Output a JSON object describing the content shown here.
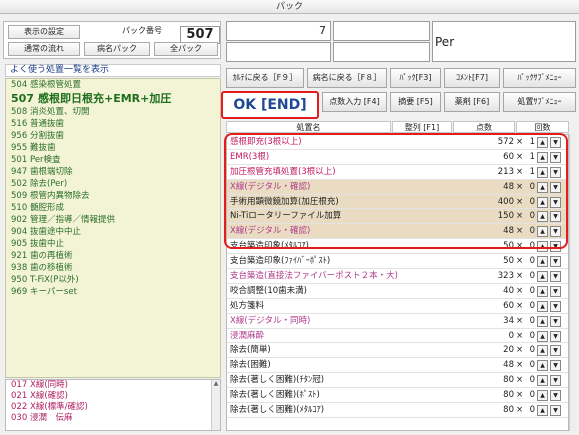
{
  "window": {
    "title": "パック"
  },
  "left": {
    "settings_label": "表示の設定",
    "pack_no_label": "パック番号",
    "pack_no": "507",
    "flow_label": "通常の流れ",
    "disease_pack_label": "病名パック",
    "all_pack_label": "全パック",
    "freq_title": "よく使う処置一覧を表示",
    "freq_items": [
      {
        "code": "504",
        "name": "感染根管処置"
      },
      {
        "code": "507",
        "name": "感根即日根充+EMR+加圧"
      },
      {
        "code": "508",
        "name": "消炎処置、切開"
      },
      {
        "code": "516",
        "name": "普通抜歯"
      },
      {
        "code": "956",
        "name": "分割抜歯"
      },
      {
        "code": "955",
        "name": "難抜歯"
      },
      {
        "code": "501",
        "name": "Per検査"
      },
      {
        "code": "947",
        "name": "歯根端切除"
      },
      {
        "code": "502",
        "name": "除去(Per)"
      },
      {
        "code": "509",
        "name": "根管内異物除去"
      },
      {
        "code": "510",
        "name": "髄腔形成"
      },
      {
        "code": "902",
        "name": "管理／指導／情報提供"
      },
      {
        "code": "904",
        "name": "抜歯途中中止"
      },
      {
        "code": "905",
        "name": "抜歯中止"
      },
      {
        "code": "921",
        "name": "歯の再植術"
      },
      {
        "code": "938",
        "name": "歯の移植術"
      },
      {
        "code": "950",
        "name": "T-FiX(P以外)"
      },
      {
        "code": "969",
        "name": "キーパーset"
      }
    ],
    "bottom_items": [
      {
        "code": "017",
        "name": "X線(同時)"
      },
      {
        "code": "021",
        "name": "X線(確認)"
      },
      {
        "code": "022",
        "name": "X線(標準/確認)"
      },
      {
        "code": "030",
        "name": "浸潤　伝麻"
      }
    ]
  },
  "right": {
    "top_value": "7",
    "per_label": "Per",
    "buttons_row1": [
      "ｶﾙﾃに戻る［F９］",
      "病名に戻る［F８］",
      "ﾊﾟｯｸ[F3]",
      "ｺﾒﾝﾄ[F7]",
      "ﾊﾟｯｸｻﾌﾞﾒﾆｭｰ"
    ],
    "ok_label": "OK [END]",
    "buttons_row2": [
      "点数入力 [F4]",
      "摘要 [F5]",
      "薬剤 [F6]",
      "処置ｻﾌﾞﾒﾆｭｰ"
    ],
    "col_name": "処置名",
    "col_sort": "整列 [F1]",
    "col_points": "点数",
    "col_times": "回数",
    "rows": [
      {
        "name": "感根即充(3根以上)",
        "points": "572",
        "times": "1",
        "style": "pink"
      },
      {
        "name": "EMR(3根)",
        "points": "60",
        "times": "1",
        "style": "pink"
      },
      {
        "name": "加圧根管充填処置(3根以上)",
        "points": "213",
        "times": "1",
        "style": "pink"
      },
      {
        "name": "X線(デジタル・確認)",
        "points": "48",
        "times": "0",
        "style": "tanp"
      },
      {
        "name": "手術用顕微鏡加算(加圧根充)",
        "points": "400",
        "times": "0",
        "style": "tan"
      },
      {
        "name": "Ni-Tiロータリーファイル加算",
        "points": "150",
        "times": "0",
        "style": "tan"
      },
      {
        "name": "X線(デジタル・確認)",
        "points": "48",
        "times": "0",
        "style": "tanp"
      },
      {
        "name": "支台築造印象(ﾒﾀﾙｺｱ)",
        "points": "50",
        "times": "0",
        "style": "white"
      },
      {
        "name": "支台築造印象(ﾌｧｲﾊﾞｰﾎﾟｽﾄ)",
        "points": "50",
        "times": "0",
        "style": "white"
      },
      {
        "name": "支台築造(直接法ファイバーポスト２本・大)",
        "points": "323",
        "times": "0",
        "style": "whitep"
      },
      {
        "name": "咬合調整(10歯未満)",
        "points": "40",
        "times": "0",
        "style": "white"
      },
      {
        "name": "処方箋料",
        "points": "60",
        "times": "0",
        "style": "white"
      },
      {
        "name": "X線(デジタル・同時)",
        "points": "34",
        "times": "0",
        "style": "whitep"
      },
      {
        "name": "浸潤麻酔",
        "points": "0",
        "times": "0",
        "style": "whitep"
      },
      {
        "name": "除去(簡単)",
        "points": "20",
        "times": "0",
        "style": "white"
      },
      {
        "name": "除去(困難)",
        "points": "48",
        "times": "0",
        "style": "white"
      },
      {
        "name": "除去(著しく困難)(ﾁﾀﾝ冠)",
        "points": "80",
        "times": "0",
        "style": "white"
      },
      {
        "name": "除去(著しく困難)(ﾎﾟｽﾄ)",
        "points": "80",
        "times": "0",
        "style": "white"
      },
      {
        "name": "除去(著しく困難)(ﾒﾀﾙｺｱ)",
        "points": "80",
        "times": "0",
        "style": "white"
      }
    ]
  }
}
